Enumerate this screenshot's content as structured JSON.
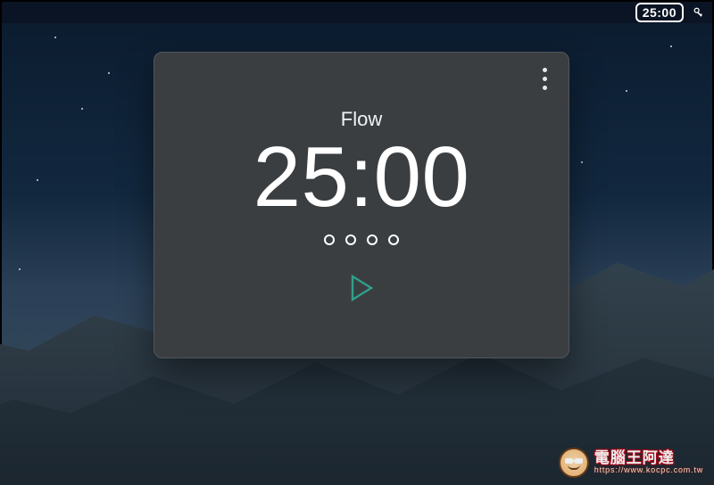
{
  "menubar": {
    "timer_badge": "25:00"
  },
  "timer": {
    "label": "Flow",
    "time": "25:00",
    "session_count": 4,
    "accent_color": "#2fa08a"
  },
  "watermark": {
    "title": "電腦王阿達",
    "url": "https://www.kocpc.com.tw"
  }
}
